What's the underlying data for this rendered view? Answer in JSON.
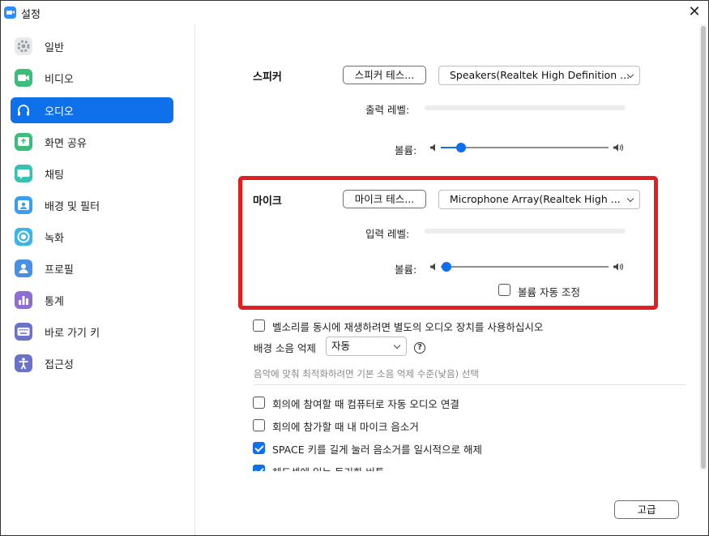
{
  "window": {
    "title": "설정"
  },
  "sidebar": {
    "items": [
      {
        "label": "일반",
        "icon": "gear-icon",
        "color": "#9aa0a6"
      },
      {
        "label": "비디오",
        "icon": "video-icon",
        "color": "#3cbd7a"
      },
      {
        "label": "오디오",
        "icon": "headphones-icon",
        "color": "#0e71eb"
      },
      {
        "label": "화면 공유",
        "icon": "share-screen-icon",
        "color": "#3cbd7a"
      },
      {
        "label": "채팅",
        "icon": "chat-icon",
        "color": "#3abfb1"
      },
      {
        "label": "배경 및 필터",
        "icon": "background-icon",
        "color": "#3a9ef0"
      },
      {
        "label": "녹화",
        "icon": "record-icon",
        "color": "#3ab5e6"
      },
      {
        "label": "프로필",
        "icon": "profile-icon",
        "color": "#4a90e2"
      },
      {
        "label": "통계",
        "icon": "stats-icon",
        "color": "#8e6fd1"
      },
      {
        "label": "바로 가기 키",
        "icon": "keyboard-icon",
        "color": "#6b72c9"
      },
      {
        "label": "접근성",
        "icon": "accessibility-icon",
        "color": "#6b72c9"
      }
    ],
    "active_index": 2
  },
  "speaker": {
    "title": "스피커",
    "test_button": "스피커 테스...",
    "device": "Speakers(Realtek High Definition ...",
    "output_level_label": "출력 레벨:",
    "volume_label": "볼륨:",
    "volume": 0.12
  },
  "mic": {
    "title": "마이크",
    "test_button": "마이크 테스...",
    "device": "Microphone Array(Realtek High ...",
    "input_level_label": "입력 레벨:",
    "volume_label": "볼륨:",
    "volume": 0.0,
    "auto_adjust_label": "볼륨 자동 조정",
    "auto_adjust_checked": false
  },
  "options": {
    "separate_ring_label": "벨소리를 동시에 재생하려면 별도의 오디오 장치를 사용하십시오",
    "noise_label": "배경 소음 억제",
    "noise_value": "자동",
    "noise_hint": "음악에 맞춰 최적화하려면 기본 소음 억제 수준(낮음) 선택",
    "join_audio_label": "회의에 참여할 때 컴퓨터로 자동 오디오 연결",
    "mute_on_join_label": "회의에 참가할 때 내 마이크 음소거",
    "space_unmute_label": "SPACE 키를 길게 눌러 음소거를 일시적으로 해제",
    "headset_sync_label": "헤드셋에 있는 동기화 버튼"
  },
  "footer": {
    "advanced_button": "고급"
  },
  "colors": {
    "accent": "#0e71eb",
    "highlight": "#e02020"
  }
}
